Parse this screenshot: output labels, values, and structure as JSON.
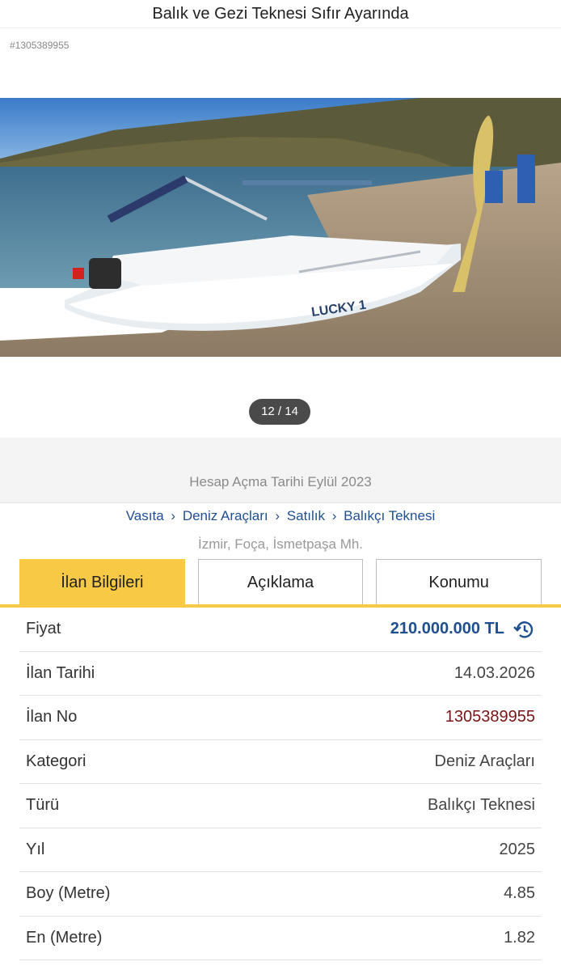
{
  "header": {
    "title": "Balık ve Gezi Teknesi Sıfır Ayarında"
  },
  "listing_ref": "#1305389955",
  "gallery": {
    "counter": "12 / 14",
    "boat_name": "LUCKY 1"
  },
  "account": {
    "opened": "Hesap Açma Tarihi  Eylül 2023"
  },
  "breadcrumb": [
    "Vasıta",
    "Deniz Araçları",
    "Satılık",
    "Balıkçı Teknesi"
  ],
  "breadcrumb_sep": "›",
  "location": "İzmir, Foça, İsmetpaşa Mh.",
  "tabs": [
    {
      "label": "İlan Bilgileri"
    },
    {
      "label": "Açıklama"
    },
    {
      "label": "Konumu"
    }
  ],
  "details": [
    {
      "label": "Fiyat",
      "value": "210.000.000 TL"
    },
    {
      "label": "İlan Tarihi",
      "value": "14.03.2026"
    },
    {
      "label": "İlan No",
      "value": "1305389955"
    },
    {
      "label": "Kategori",
      "value": "Deniz Araçları"
    },
    {
      "label": "Türü",
      "value": "Balıkçı Teknesi"
    },
    {
      "label": "Yıl",
      "value": "2025"
    },
    {
      "label": "Boy (Metre)",
      "value": "4.85"
    },
    {
      "label": "En (Metre)",
      "value": "1.82"
    }
  ],
  "colors": {
    "accent": "#f7c944",
    "link": "#1f4f8f",
    "listing_no": "#7a1414"
  }
}
